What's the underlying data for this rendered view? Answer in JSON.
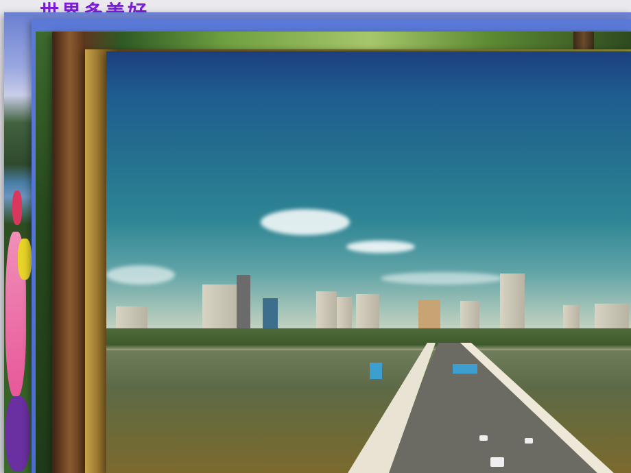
{
  "slide": {
    "title": "世界多美好"
  }
}
